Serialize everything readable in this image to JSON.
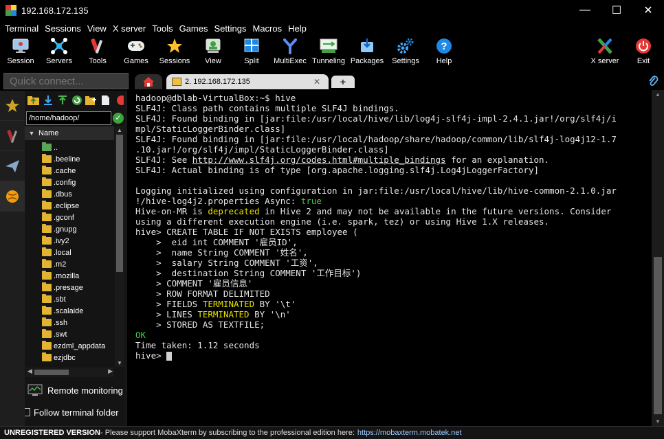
{
  "window": {
    "title": "192.168.172.135",
    "minimize": "—",
    "maximize": "☐",
    "close": "✕"
  },
  "menu": [
    "Terminal",
    "Sessions",
    "View",
    "X server",
    "Tools",
    "Games",
    "Settings",
    "Macros",
    "Help"
  ],
  "toolbar": {
    "session": "Session",
    "servers": "Servers",
    "tools": "Tools",
    "games": "Games",
    "sessions": "Sessions",
    "view": "View",
    "split": "Split",
    "multiexec": "MultiExec",
    "tunneling": "Tunneling",
    "packages": "Packages",
    "settings": "Settings",
    "help": "Help",
    "xserver": "X server",
    "exit": "Exit"
  },
  "quick_connect": {
    "placeholder": "Quick connect..."
  },
  "sidebar": {
    "path": "/home/hadoop/",
    "name_header": "Name",
    "files": [
      "..",
      ".beeline",
      ".cache",
      ".config",
      ".dbus",
      ".eclipse",
      ".gconf",
      ".gnupg",
      ".ivy2",
      ".local",
      ".m2",
      ".mozilla",
      ".presage",
      ".sbt",
      ".scalaide",
      ".ssh",
      ".swt",
      "ezdml_appdata",
      "ezjdbc"
    ],
    "remote_monitoring": "Remote monitoring",
    "follow_terminal": "Follow terminal folder"
  },
  "tabs": {
    "session_label": "2. 192.168.172.135",
    "close": "✕",
    "new": "+"
  },
  "terminal": {
    "lines": [
      [
        {
          "t": "hadoop@dblab-VirtualBox:~$ hive"
        }
      ],
      [
        {
          "t": "SLF4J: Class path contains multiple SLF4J bindings."
        }
      ],
      [
        {
          "t": "SLF4J: Found binding in [jar:file:/usr/local/hive/lib/log4j-slf4j-impl-2.4.1.jar!/org/slf4j/i"
        }
      ],
      [
        {
          "t": "mpl/StaticLoggerBinder.class]"
        }
      ],
      [
        {
          "t": "SLF4J: Found binding in [jar:file:/usr/local/hadoop/share/hadoop/common/lib/slf4j-log4j12-1.7"
        }
      ],
      [
        {
          "t": ".10.jar!/org/slf4j/impl/StaticLoggerBinder.class]"
        }
      ],
      [
        {
          "t": "SLF4J: See "
        },
        {
          "t": "http://www.slf4j.org/codes.html#multiple_bindings",
          "c": "link"
        },
        {
          "t": " for an explanation."
        }
      ],
      [
        {
          "t": "SLF4J: Actual binding is of type [org.apache.logging.slf4j.Log4jLoggerFactory]"
        }
      ],
      [
        {
          "t": ""
        }
      ],
      [
        {
          "t": "Logging initialized using configuration in jar:file:/usr/local/hive/lib/hive-common-2.1.0.jar"
        }
      ],
      [
        {
          "t": "!/hive-log4j2.properties Async: "
        },
        {
          "t": "true",
          "c": "green"
        }
      ],
      [
        {
          "t": "Hive-on-MR is "
        },
        {
          "t": "deprecated",
          "c": "yellow"
        },
        {
          "t": " in Hive 2 and may not be available in the future versions. Consider"
        }
      ],
      [
        {
          "t": "using a different execution engine (i.e. spark, tez) or using Hive 1.X releases."
        }
      ],
      [
        {
          "t": "hive> CREATE TABLE IF NOT EXISTS employee ("
        }
      ],
      [
        {
          "t": "    >  eid int COMMENT '雇员ID',"
        }
      ],
      [
        {
          "t": "    >  name String COMMENT '姓名',"
        }
      ],
      [
        {
          "t": "    >  salary String COMMENT '工资',"
        }
      ],
      [
        {
          "t": "    >  destination String COMMENT '工作目标')"
        }
      ],
      [
        {
          "t": "    > COMMENT '雇员信息'"
        }
      ],
      [
        {
          "t": "    > ROW FORMAT DELIMITED"
        }
      ],
      [
        {
          "t": "    > FIELDS "
        },
        {
          "t": "TERMINATED",
          "c": "yellow"
        },
        {
          "t": " BY '\\t'"
        }
      ],
      [
        {
          "t": "    > LINES "
        },
        {
          "t": "TERMINATED",
          "c": "yellow"
        },
        {
          "t": " BY '\\n'"
        }
      ],
      [
        {
          "t": "    > STORED AS TEXTFILE;"
        }
      ],
      [
        {
          "t": "OK",
          "c": "green"
        }
      ],
      [
        {
          "t": "Time taken: 1.12 seconds"
        }
      ],
      [
        {
          "t": "hive> "
        },
        {
          "t": "",
          "c": "cursor"
        }
      ]
    ]
  },
  "statusbar": {
    "unregistered": "UNREGISTERED VERSION",
    "message": " -  Please support MobaXterm by subscribing to the professional edition here: ",
    "url": "https://mobaxterm.mobatek.net"
  }
}
